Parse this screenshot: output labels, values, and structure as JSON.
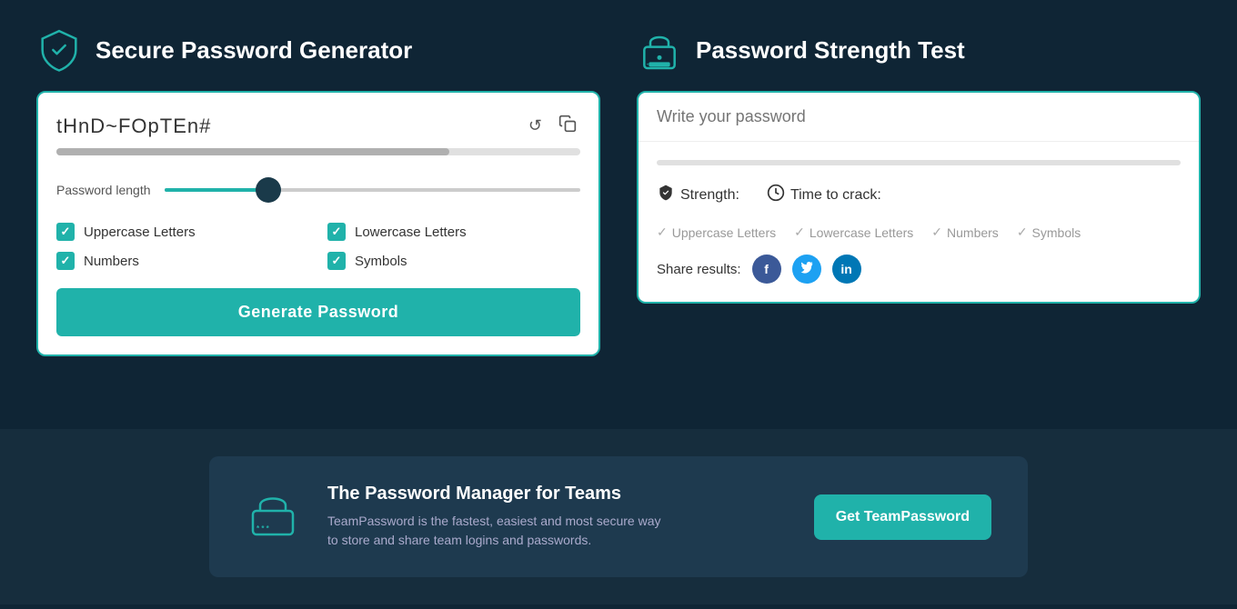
{
  "generator": {
    "title": "Secure Password Generator",
    "generated_password": "tHnD~FOpTEn#",
    "password_length_label": "Password length",
    "options": [
      {
        "id": "uppercase",
        "label": "Uppercase Letters",
        "checked": true
      },
      {
        "id": "lowercase",
        "label": "Lowercase Letters",
        "checked": true
      },
      {
        "id": "numbers",
        "label": "Numbers",
        "checked": true
      },
      {
        "id": "symbols",
        "label": "Symbols",
        "checked": true
      }
    ],
    "generate_button_label": "Generate Password"
  },
  "strength_test": {
    "title": "Password Strength Test",
    "input_placeholder": "Write your password",
    "strength_label": "Strength:",
    "time_to_crack_label": "Time to crack:",
    "checks": [
      {
        "label": "Uppercase Letters"
      },
      {
        "label": "Lowercase Letters"
      },
      {
        "label": "Numbers"
      },
      {
        "label": "Symbols"
      }
    ],
    "share_label": "Share results:"
  },
  "banner": {
    "title": "The Password Manager for Teams",
    "subtitle": "TeamPassword is the fastest, easiest and most secure way\nto store and share team logins and passwords.",
    "cta_label": "Get TeamPassword"
  },
  "icons": {
    "refresh": "↺",
    "copy": "❐",
    "facebook": "f",
    "twitter": "t",
    "linkedin": "in"
  }
}
